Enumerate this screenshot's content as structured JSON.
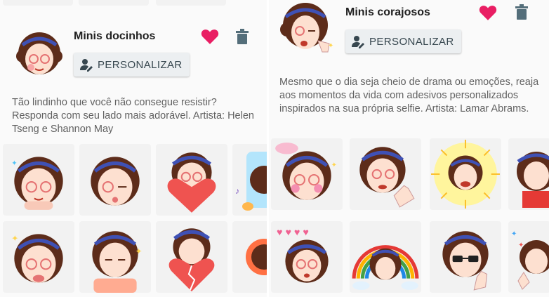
{
  "left_pack": {
    "title": "Minis docinhos",
    "button_label": "PERSONALIZAR",
    "description": "Tão lindinho que você não consegue resistir? Responda com seu lado mais adorável. Artista: Helen Tseng e Shannon May",
    "heart_icon": "heart-icon",
    "trash_icon": "trash-icon"
  },
  "right_pack": {
    "title": "Minis corajosos",
    "button_label": "PERSONALIZAR",
    "description": "Mesmo que o dia seja cheio de drama ou emoções, reaja aos momentos da vida com adesivos personalizados inspirados na sua própria selfie. Artista: Lamar Abrams.",
    "heart_icon": "heart-icon",
    "trash_icon": "trash-icon"
  },
  "colors": {
    "heart": "#e91e63",
    "trash": "#546e7a",
    "button_bg": "#eceff1",
    "button_text": "#37474f",
    "hair": "#5d2c1a",
    "headband": "#3f51b5",
    "skin": "#fde0d0",
    "glasses": "#e57373"
  }
}
